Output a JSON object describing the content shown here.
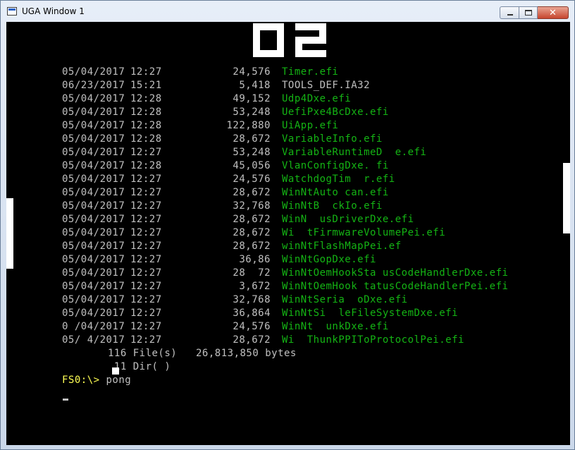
{
  "window": {
    "title": "UGA Window 1"
  },
  "window_buttons": {
    "minimize": "minimize",
    "maximize": "maximize",
    "close": "✕"
  },
  "game": {
    "score": "02"
  },
  "console": {
    "files": [
      {
        "date": "05/04/2017",
        "time": "12:27",
        "size": "24,576",
        "name": "Timer.efi",
        "color": "green"
      },
      {
        "date": "06/23/2017",
        "time": "15:21",
        "size": "5,418",
        "name": "TOOLS_DEF.IA32",
        "color": "gray"
      },
      {
        "date": "05/04/2017",
        "time": "12:28",
        "size": "49,152",
        "name": "Udp4Dxe.efi",
        "color": "green"
      },
      {
        "date": "05/04/2017",
        "time": "12:28",
        "size": "53,248",
        "name": "UefiPxe4BcDxe.efi",
        "color": "green"
      },
      {
        "date": "05/04/2017",
        "time": "12:28",
        "size": "122,880",
        "name": "UiApp.efi",
        "color": "green"
      },
      {
        "date": "05/04/2017",
        "time": "12:28",
        "size": "28,672",
        "name": "VariableInfo.efi",
        "color": "green"
      },
      {
        "date": "05/04/2017",
        "time": "12:27",
        "size": "53,248",
        "name": "VariableRuntimeD  e.efi",
        "color": "green"
      },
      {
        "date": "05/04/2017",
        "time": "12:28",
        "size": "45,056",
        "name": "VlanConfigDxe. fi",
        "color": "green"
      },
      {
        "date": "05/04/2017",
        "time": "12:27",
        "size": "24,576",
        "name": "WatchdogTim  r.efi",
        "color": "green"
      },
      {
        "date": "05/04/2017",
        "time": "12:27",
        "size": "28,672",
        "name": "WinNtAuto can.efi",
        "color": "green"
      },
      {
        "date": "05/04/2017",
        "time": "12:27",
        "size": "32,768",
        "name": "WinNtB  ckIo.efi",
        "color": "green"
      },
      {
        "date": "05/04/2017",
        "time": "12:27",
        "size": "28,672",
        "name": "WinN  usDriverDxe.efi",
        "color": "green"
      },
      {
        "date": "05/04/2017",
        "time": "12:27",
        "size": "28,672",
        "name": "Wi  tFirmwareVolumePei.efi",
        "color": "green"
      },
      {
        "date": "05/04/2017",
        "time": "12:27",
        "size": "28,672",
        "name": "winNtFlashMapPei.ef",
        "color": "green"
      },
      {
        "date": "05/04/2017",
        "time": "12:27",
        "size": "36,86",
        "name": "WinNtGopDxe.efi",
        "color": "green"
      },
      {
        "date": "05/04/2017",
        "time": "12:27",
        "size": "28  72",
        "name": "WinNtOemHookSta usCodeHandlerDxe.efi",
        "color": "green"
      },
      {
        "date": "05/04/2017",
        "time": "12:27",
        "size": "3,672",
        "name": "WinNtOemHook tatusCodeHandlerPei.efi",
        "color": "green"
      },
      {
        "date": "05/04/2017",
        "time": "12:27",
        "size": "32,768",
        "name": "WinNtSeria  oDxe.efi",
        "color": "green"
      },
      {
        "date": "05/04/2017",
        "time": "12:27",
        "size": "36,864",
        "name": "WinNtSi  leFileSystemDxe.efi",
        "color": "green"
      },
      {
        "date": "0 /04/2017",
        "time": "12:27",
        "size": "24,576",
        "name": "WinNt  unkDxe.efi",
        "color": "green"
      },
      {
        "date": "05/ 4/2017",
        "time": "12:27",
        "size": "28,672",
        "name": "Wi  ThunkPPIToProtocolPei.efi",
        "color": "green"
      }
    ],
    "summary": {
      "files": "116 File(s)   26,813,850 bytes",
      "dirs": " 11 Dir( )"
    },
    "prompt": {
      "label": "FS0:\\>",
      "command": " pong"
    }
  },
  "colors": {
    "green": "#14b414",
    "gray": "#c0c0c0",
    "prompt": "#ffff54",
    "background": "#000000"
  }
}
